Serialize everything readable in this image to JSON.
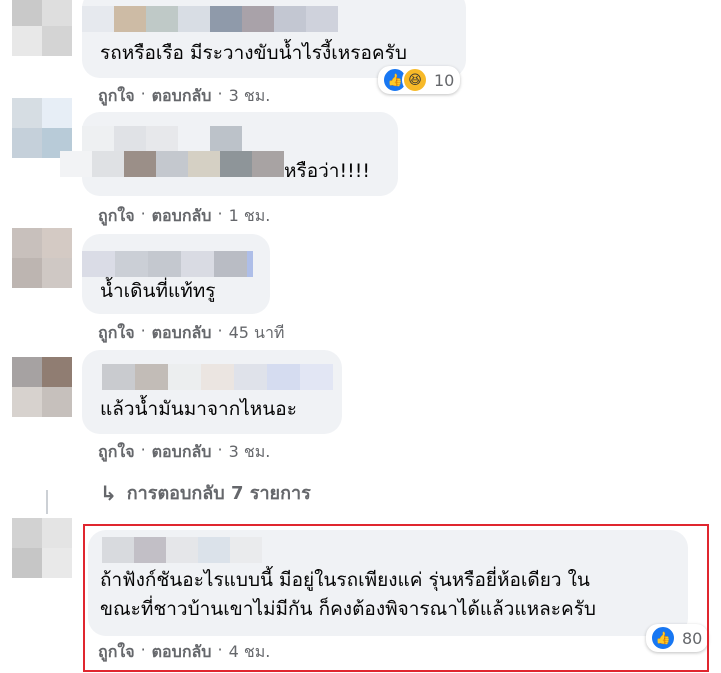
{
  "comments": [
    {
      "text": "รถหรือเรือ มีระวางขับน้ำไรงี้เหรอครับ",
      "like": "ถูกใจ",
      "reply": "ตอบกลับ",
      "time": "3 ชม.",
      "reaction_count": "10"
    },
    {
      "text": "หรือว่า!!!!",
      "like": "ถูกใจ",
      "reply": "ตอบกลับ",
      "time": "1 ชม."
    },
    {
      "text": "น้ำเดินที่แท้ทรู",
      "like": "ถูกใจ",
      "reply": "ตอบกลับ",
      "time": "45 นาที"
    },
    {
      "text": "แล้วน้ำมันมาจากไหนอะ",
      "like": "ถูกใจ",
      "reply": "ตอบกลับ",
      "time": "3 ชม."
    },
    {
      "text_line1": "ถ้าฟังก์ชันอะไรแบบนี้ มีอยู่ในรถเพียงแค่ รุ่นหรือยี่ห้อเดียว ใน",
      "text_line2": "ขณะที่ชาวบ้านเขาไม่มีกัน ก็คงต้องพิจารณาได้แล้วแหละครับ",
      "like": "ถูกใจ",
      "reply": "ตอบกลับ",
      "time": "4 ชม.",
      "reaction_count": "80"
    }
  ],
  "view_replies": "การตอบกลับ 7 รายการ",
  "colors": {
    "highlight": "#e0262f",
    "like_blue": "#1877f2",
    "bubble": "#f0f2f5"
  },
  "icons": {
    "like": "thumbs-up-icon",
    "haha": "haha-emoji-icon",
    "reply_arrow": "reply-arrow-icon"
  }
}
